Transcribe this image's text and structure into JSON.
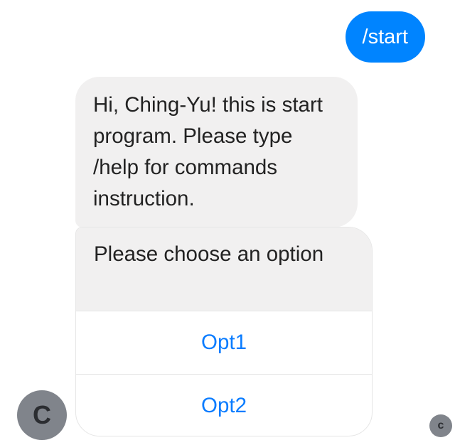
{
  "messages": {
    "outgoing": {
      "text": "/start"
    },
    "incoming": {
      "text": "Hi, Ching-Yu! this is start program. Please type /help for commands instruction."
    }
  },
  "card": {
    "prompt": "Please choose an option",
    "options": [
      {
        "label": "Opt1"
      },
      {
        "label": "Opt2"
      }
    ]
  },
  "avatars": {
    "bot_initial": "C",
    "read_receipt_initial": "c"
  },
  "colors": {
    "outgoing_bubble": "#0084ff",
    "incoming_bubble": "#f1f0f0",
    "option_text": "#0a7cff",
    "avatar_bg": "#80848b"
  }
}
